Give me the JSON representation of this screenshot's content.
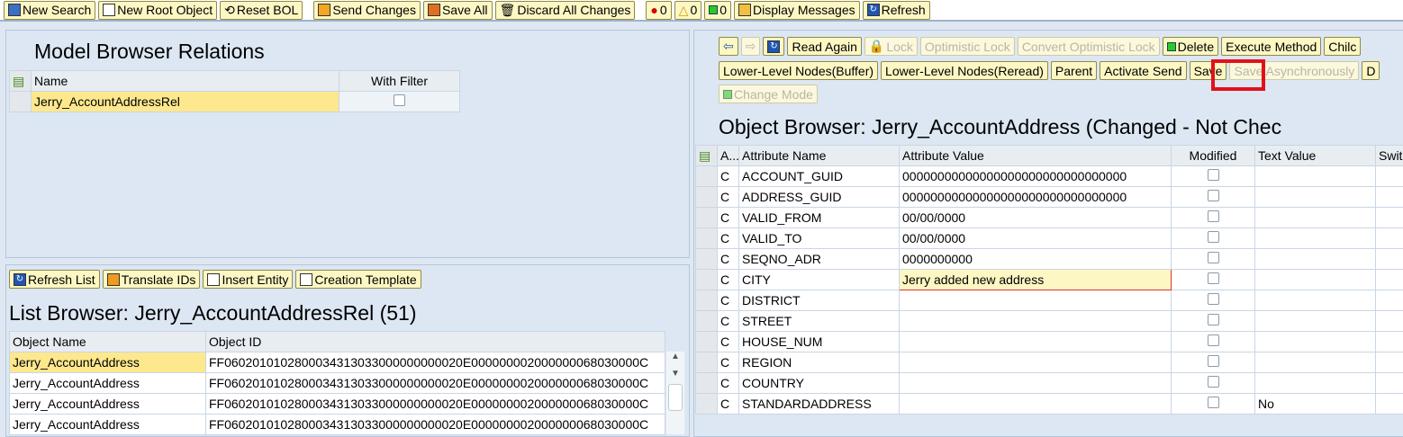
{
  "toolbar": {
    "new_search": "New Search",
    "new_root": "New Root Object",
    "reset_bol": "Reset BOL",
    "send_changes": "Send Changes",
    "save_all": "Save All",
    "discard": "Discard All Changes",
    "errors": "0",
    "warnings": "0",
    "success": "0",
    "display_messages": "Display Messages",
    "refresh": "Refresh"
  },
  "relations": {
    "title": "Model Browser Relations",
    "col_name": "Name",
    "col_filter": "With Filter",
    "rows": [
      {
        "name": "Jerry_AccountAddressRel"
      }
    ]
  },
  "list": {
    "buttons": [
      "Refresh List",
      "Translate IDs",
      "Insert Entity",
      "Creation Template"
    ],
    "title": "List Browser: Jerry_AccountAddressRel (51)",
    "col_name": "Object Name",
    "col_id": "Object ID",
    "rows": [
      {
        "name": "Jerry_AccountAddress",
        "id": "FF0602010102800034313033000000000020E000000002000000068030000C"
      },
      {
        "name": "Jerry_AccountAddress",
        "id": "FF0602010102800034313033000000000020E000000002000000068030000C"
      },
      {
        "name": "Jerry_AccountAddress",
        "id": "FF0602010102800034313033000000000020E000000002000000068030000C"
      },
      {
        "name": "Jerry_AccountAddress",
        "id": "FF0602010102800034313033000000000020E000000002000000068030000C"
      }
    ]
  },
  "object": {
    "buttons1": [
      "Read Again",
      "Lock",
      "Optimistic Lock",
      "Convert Optimistic Lock",
      "Delete",
      "Execute Method",
      "Chilc"
    ],
    "buttons2": [
      "Lower-Level Nodes(Buffer)",
      "Lower-Level Nodes(Reread)",
      "Parent",
      "Activate Send",
      "Save",
      "Save Asynchronously",
      "D"
    ],
    "change_mode": "Change Mode",
    "title": "Object Browser: Jerry_AccountAddress (Changed - Not Chec",
    "cols": [
      "A...",
      "Attribute Name",
      "Attribute Value",
      "Modified",
      "Text Value",
      "Swit"
    ],
    "rows": [
      {
        "a": "C",
        "name": "ACCOUNT_GUID",
        "value": "00000000000000000000000000000000",
        "text": ""
      },
      {
        "a": "C",
        "name": "ADDRESS_GUID",
        "value": "00000000000000000000000000000000",
        "text": ""
      },
      {
        "a": "C",
        "name": "VALID_FROM",
        "value": "00/00/0000",
        "text": ""
      },
      {
        "a": "C",
        "name": "VALID_TO",
        "value": "00/00/0000",
        "text": ""
      },
      {
        "a": "C",
        "name": "SEQNO_ADR",
        "value": "0000000000",
        "text": ""
      },
      {
        "a": "C",
        "name": "CITY",
        "value": "Jerry added new address",
        "text": ""
      },
      {
        "a": "C",
        "name": "DISTRICT",
        "value": "",
        "text": ""
      },
      {
        "a": "C",
        "name": "STREET",
        "value": "",
        "text": ""
      },
      {
        "a": "C",
        "name": "HOUSE_NUM",
        "value": "",
        "text": ""
      },
      {
        "a": "C",
        "name": "REGION",
        "value": "",
        "text": ""
      },
      {
        "a": "C",
        "name": "COUNTRY",
        "value": "",
        "text": ""
      },
      {
        "a": "C",
        "name": "STANDARDADDRESS",
        "value": "",
        "text": "No"
      }
    ]
  }
}
